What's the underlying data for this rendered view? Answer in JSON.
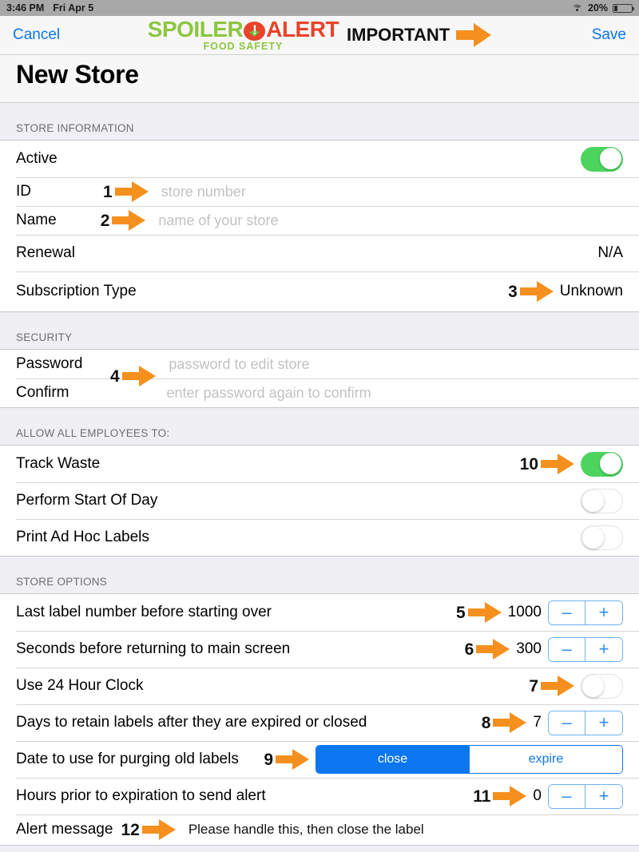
{
  "statusbar": {
    "time": "3:46 PM",
    "date": "Fri Apr 5",
    "wifi_icon": "wifi-icon",
    "battery_percent": "20%",
    "battery_level": 20
  },
  "navbar": {
    "cancel_label": "Cancel",
    "save_label": "Save",
    "important_label": "IMPORTANT",
    "brand": {
      "word1": "SPOILER",
      "word2": "ALERT",
      "tagline": "FOOD SAFETY",
      "tomato_icon": "tomato-exclamation-icon"
    }
  },
  "page": {
    "title": "New Store"
  },
  "sections": {
    "store_information": {
      "header": "STORE INFORMATION",
      "rows": {
        "active": {
          "label": "Active",
          "switch": "on"
        },
        "id": {
          "label": "ID",
          "placeholder": "store number",
          "value": "",
          "marker": "1"
        },
        "name": {
          "label": "Name",
          "placeholder": "name of your store",
          "value": "",
          "marker": "2"
        },
        "renewal": {
          "label": "Renewal",
          "value": "N/A"
        },
        "subscription_type": {
          "label": "Subscription Type",
          "value": "Unknown",
          "marker": "3"
        }
      }
    },
    "security": {
      "header": "SECURITY",
      "rows": {
        "password": {
          "label": "Password",
          "placeholder": "password to edit store",
          "value": "",
          "marker": "4"
        },
        "confirm": {
          "label": "Confirm",
          "placeholder": "enter password again to confirm",
          "value": ""
        }
      }
    },
    "allow_all_employees": {
      "header": "ALLOW ALL EMPLOYEES TO:",
      "rows": {
        "track_waste": {
          "label": "Track Waste",
          "switch": "on",
          "marker": "10"
        },
        "perform_start_of_day": {
          "label": "Perform Start Of Day",
          "switch": "off"
        },
        "print_ad_hoc_labels": {
          "label": "Print Ad Hoc Labels",
          "switch": "off"
        }
      }
    },
    "store_options": {
      "header": "STORE OPTIONS",
      "rows": {
        "last_label_number": {
          "label": "Last label number before starting over",
          "value": "1000",
          "marker": "5",
          "minus": "–",
          "plus": "+"
        },
        "seconds_before_return": {
          "label": "Seconds before returning to main screen",
          "value": "300",
          "marker": "6",
          "minus": "–",
          "plus": "+"
        },
        "use_24_hour_clock": {
          "label": "Use 24 Hour Clock",
          "switch": "off",
          "marker": "7"
        },
        "days_to_retain": {
          "label": "Days to retain labels after they are expired or closed",
          "value": "7",
          "marker": "8",
          "minus": "–",
          "plus": "+"
        },
        "purge_date": {
          "label": "Date to use for purging old labels",
          "marker": "9",
          "options": [
            "close",
            "expire"
          ],
          "selected": "close"
        },
        "hours_prior_alert": {
          "label": "Hours prior to expiration to send alert",
          "value": "0",
          "marker": "11",
          "minus": "–",
          "plus": "+"
        },
        "alert_message": {
          "label": "Alert message",
          "value": "Please handle this, then close the label",
          "marker": "12"
        }
      }
    }
  },
  "colors": {
    "accent_blue": "#0b76ef",
    "arrow_orange": "#f5901f",
    "switch_green": "#4cd45f",
    "brand_green": "#8cc63f",
    "brand_red": "#e8432b",
    "section_header_gray": "#6d6d72"
  }
}
